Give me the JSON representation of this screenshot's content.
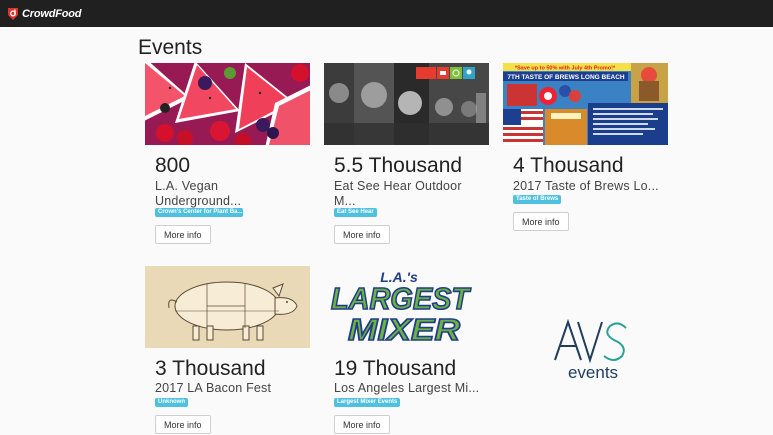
{
  "app": {
    "name": "CrowdFood"
  },
  "page": {
    "title": "Events"
  },
  "events": [
    {
      "attendance": "800",
      "name_line1": "L.A. Vegan",
      "name_line2": "Underground...",
      "organizer": "Crown's Center for Plant Ba...",
      "more_label": "More info"
    },
    {
      "attendance": "5.5 Thousand",
      "name_line1": "Eat See Hear Outdoor",
      "name_line2": "M...",
      "organizer": "Eat See Hear",
      "more_label": "More info"
    },
    {
      "attendance": "4 Thousand",
      "name_line1": "2017 Taste of Brews Lo...",
      "name_line2": "",
      "organizer": "Taste of Brews",
      "more_label": "More info",
      "image_text": {
        "banner": "*Save up to 50% with July 4th Promo!*",
        "title": "7TH TASTE OF BREWS LONG BEACH"
      }
    },
    {
      "attendance": "3 Thousand",
      "name_line1": "2017 LA Bacon Fest",
      "name_line2": "",
      "organizer": "Unknown",
      "more_label": "More info"
    },
    {
      "attendance": "19 Thousand",
      "name_line1": "Los Angeles Largest Mi...",
      "name_line2": "",
      "organizer": "Largest Mixer Events",
      "more_label": "More info",
      "image_text": {
        "top": "L.A.'s",
        "line1": "LARGEST",
        "line2": "MIXER"
      }
    },
    {
      "logo_text": {
        "mark": "AVS",
        "sub": "events"
      }
    }
  ]
}
